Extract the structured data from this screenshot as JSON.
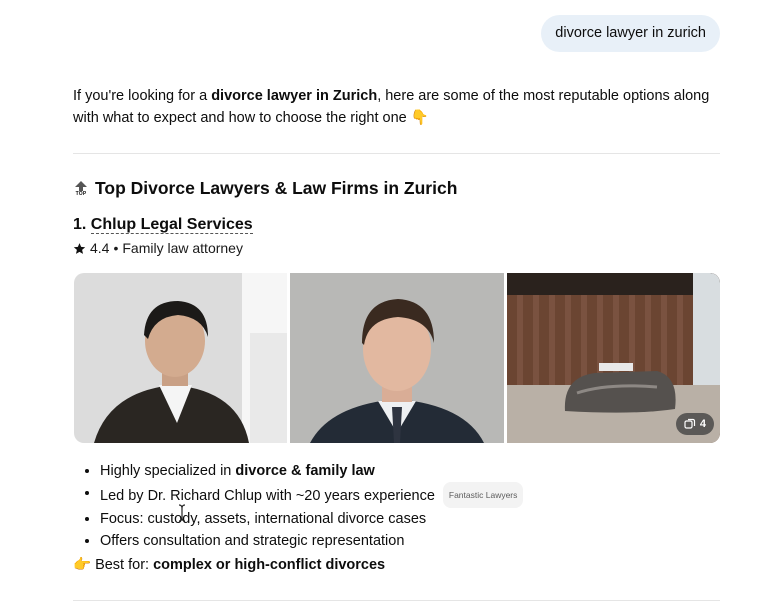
{
  "user_message": "divorce lawyer in zurich",
  "intro": {
    "before": "If you're looking for a ",
    "bold": "divorce lawyer in Zurich",
    "after": ", here are some of the most reputable options along with what to expect and how to choose the right one",
    "emoji": "👇"
  },
  "section": {
    "title": "Top Divorce Lawyers & Law Firms in Zurich",
    "icon_label": "TOP"
  },
  "listing": {
    "number": "1.",
    "name": "Chlup Legal Services",
    "rating": "4.4",
    "separator": "•",
    "category": "Family law attorney",
    "image_count": "4",
    "bullets": [
      {
        "text": "Highly specialized in ",
        "bold": "divorce & family law"
      },
      {
        "text": "Led by Dr. Richard Chlup with ~20 years experience",
        "source": "Fantastic Lawyers"
      },
      {
        "text": "Focus: custody, assets, international divorce cases"
      },
      {
        "text": "Offers consultation and strategic representation"
      }
    ],
    "best_for": {
      "emoji": "👉",
      "label": "Best for: ",
      "bold": "complex or high-conflict divorces"
    }
  },
  "colors": {
    "user_bubble_bg": "#e8f0f8",
    "divider": "#e5e5e5"
  }
}
